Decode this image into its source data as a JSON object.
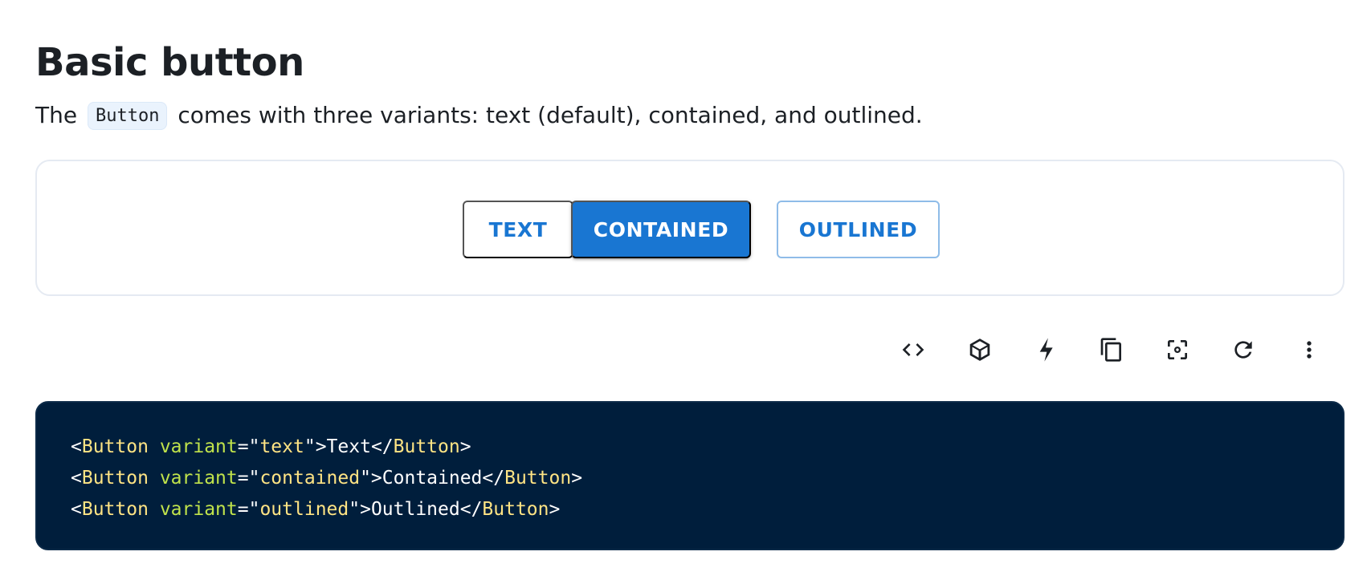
{
  "section": {
    "title": "Basic button",
    "description_before": "The ",
    "description_code": "Button",
    "description_after": " comes with three variants: text (default), contained, and outlined."
  },
  "demo": {
    "buttons": [
      {
        "variant": "text",
        "label": "TEXT"
      },
      {
        "variant": "contained",
        "label": "CONTAINED"
      },
      {
        "variant": "outlined",
        "label": "OUTLINED"
      }
    ]
  },
  "toolbar": {
    "icons": [
      "code-icon",
      "codesandbox-icon",
      "stackblitz-icon",
      "copy-icon",
      "reset-focus-icon",
      "reset-demo-icon",
      "more-options-icon"
    ]
  },
  "code": {
    "lines": [
      {
        "tag": "Button",
        "attr": "variant",
        "value": "text",
        "children": "Text"
      },
      {
        "tag": "Button",
        "attr": "variant",
        "value": "contained",
        "children": "Contained"
      },
      {
        "tag": "Button",
        "attr": "variant",
        "value": "outlined",
        "children": "Outlined"
      }
    ]
  },
  "colors": {
    "primary": "#1976d2",
    "code_background": "#001e3c",
    "code_tag": "#ffe484",
    "code_attr": "#c0e34b"
  }
}
